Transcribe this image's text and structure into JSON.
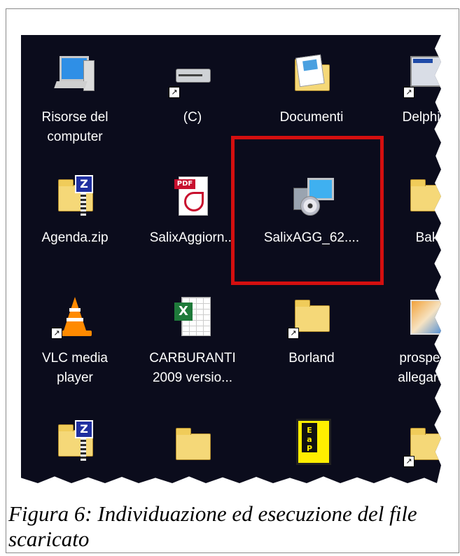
{
  "desktop": {
    "icons": [
      {
        "label": "Risorse del computer",
        "line1": "Risorse del",
        "line2": "computer",
        "icon": "my-computer-icon"
      },
      {
        "label": "(C)",
        "line1": "(C)",
        "line2": "",
        "icon": "hard-drive-icon"
      },
      {
        "label": "Documenti",
        "line1": "Documenti",
        "line2": "",
        "icon": "my-documents-icon"
      },
      {
        "label": "Delphi F",
        "line1": "Delphi F",
        "line2": "",
        "icon": "delphi-project-icon"
      },
      {
        "label": "Agenda.zip",
        "line1": "Agenda.zip",
        "line2": "",
        "icon": "zip-folder-icon"
      },
      {
        "label": "SalixAggiorn...",
        "line1": "SalixAggiorn...",
        "line2": "",
        "icon": "pdf-file-icon"
      },
      {
        "label": "SalixAGG_62....",
        "line1": "SalixAGG_62....",
        "line2": "",
        "icon": "setup-installer-icon"
      },
      {
        "label": "Bak",
        "line1": "Bak",
        "line2": "",
        "icon": "folder-icon"
      },
      {
        "label": "VLC media player",
        "line1": "VLC media",
        "line2": "player",
        "icon": "vlc-icon"
      },
      {
        "label": "CARBURANTI 2009 versio...",
        "line1": "CARBURANTI",
        "line2": "2009 versio...",
        "icon": "excel-file-icon"
      },
      {
        "label": "Borland",
        "line1": "Borland",
        "line2": "",
        "icon": "folder-icon"
      },
      {
        "label": "prospetto allegare p",
        "line1": "prospetto",
        "line2": "allegare p",
        "icon": "image-file-icon"
      }
    ],
    "bottom_row_icons": [
      "zip-folder-icon",
      "folder-icon",
      "eap-icon",
      "folder-icon"
    ],
    "highlight_color": "#d40f0f",
    "background_color": "#0b0c1c"
  },
  "caption": "Figura 6: Individuazione ed esecuzione del file scaricato"
}
